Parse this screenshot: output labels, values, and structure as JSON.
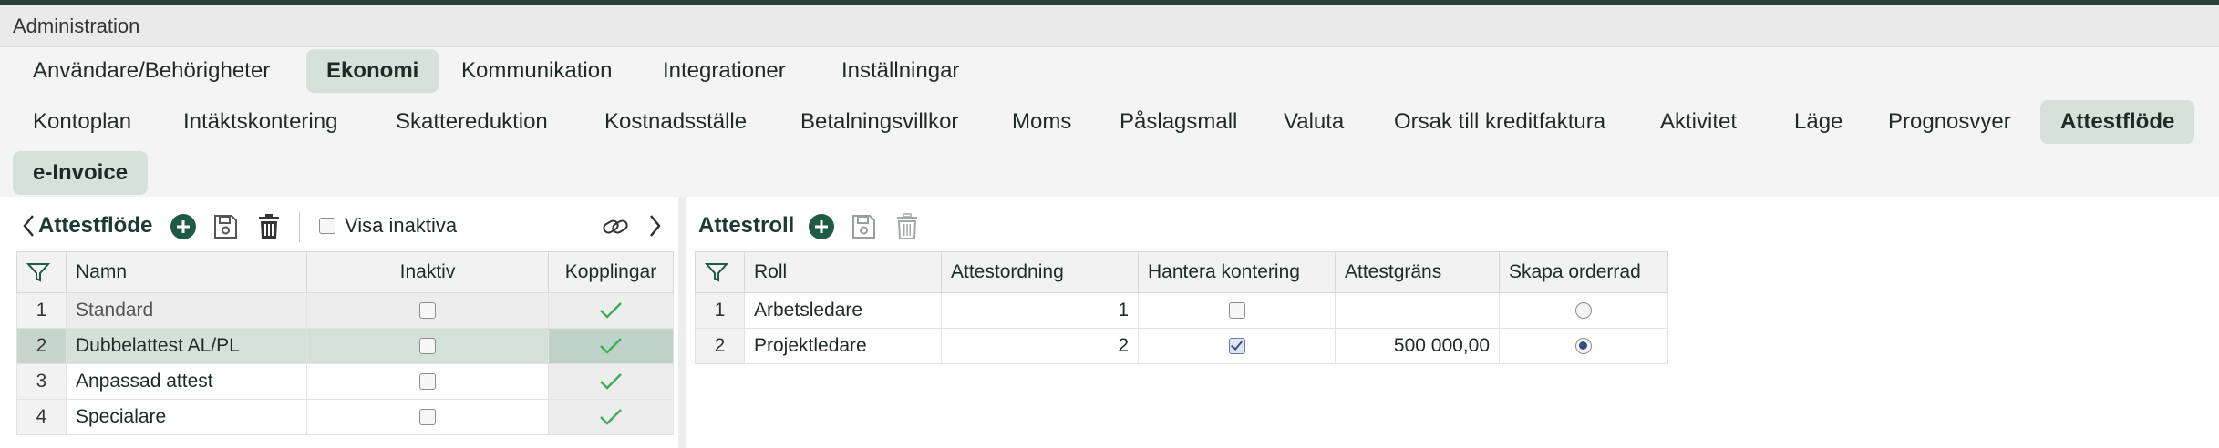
{
  "window": {
    "title": "Administration"
  },
  "main_tabs": [
    {
      "label": "Användare/Behörigheter",
      "active": false
    },
    {
      "label": "Ekonomi",
      "active": true
    },
    {
      "label": "Kommunikation",
      "active": false
    },
    {
      "label": "Integrationer",
      "active": false
    },
    {
      "label": "Inställningar",
      "active": false
    }
  ],
  "sub_tabs": [
    {
      "label": "Kontoplan"
    },
    {
      "label": "Intäktskontering"
    },
    {
      "label": "Skattereduktion"
    },
    {
      "label": "Kostnadsställe"
    },
    {
      "label": "Betalningsvillkor"
    },
    {
      "label": "Moms"
    },
    {
      "label": "Påslagsmall"
    },
    {
      "label": "Valuta"
    },
    {
      "label": "Orsak till kreditfaktura"
    },
    {
      "label": "Aktivitet"
    },
    {
      "label": "Läge"
    },
    {
      "label": "Prognosvyer"
    },
    {
      "label": "Attestflöde",
      "active": true
    },
    {
      "label": "e-Invoice"
    }
  ],
  "left_panel": {
    "title": "Attestflöde",
    "show_inactive_label": "Visa inaktiva",
    "show_inactive_checked": false,
    "columns": [
      "Namn",
      "Inaktiv",
      "Kopplingar"
    ],
    "rows": [
      {
        "num": "1",
        "name": "Standard",
        "inactive": false,
        "linked": true
      },
      {
        "num": "2",
        "name": "Dubbelattest AL/PL",
        "inactive": false,
        "linked": true,
        "selected": true
      },
      {
        "num": "3",
        "name": "Anpassad attest",
        "inactive": false,
        "linked": true
      },
      {
        "num": "4",
        "name": "Specialare",
        "inactive": false,
        "linked": true
      }
    ]
  },
  "right_panel": {
    "title": "Attestroll",
    "columns": [
      "Roll",
      "Attestordning",
      "Hantera kontering",
      "Attestgräns",
      "Skapa orderrad"
    ],
    "rows": [
      {
        "num": "1",
        "role": "Arbetsledare",
        "order": "1",
        "handle_posting": false,
        "limit": "",
        "create_order_row": false
      },
      {
        "num": "2",
        "role": "Projektledare",
        "order": "2",
        "handle_posting": true,
        "limit": "500 000,00",
        "create_order_row": true
      }
    ]
  },
  "colors": {
    "accent": "#1f5a45",
    "active_tab": "#d6e1dc",
    "selected_row": "#d4e1db",
    "check_green": "#3fae5a"
  }
}
